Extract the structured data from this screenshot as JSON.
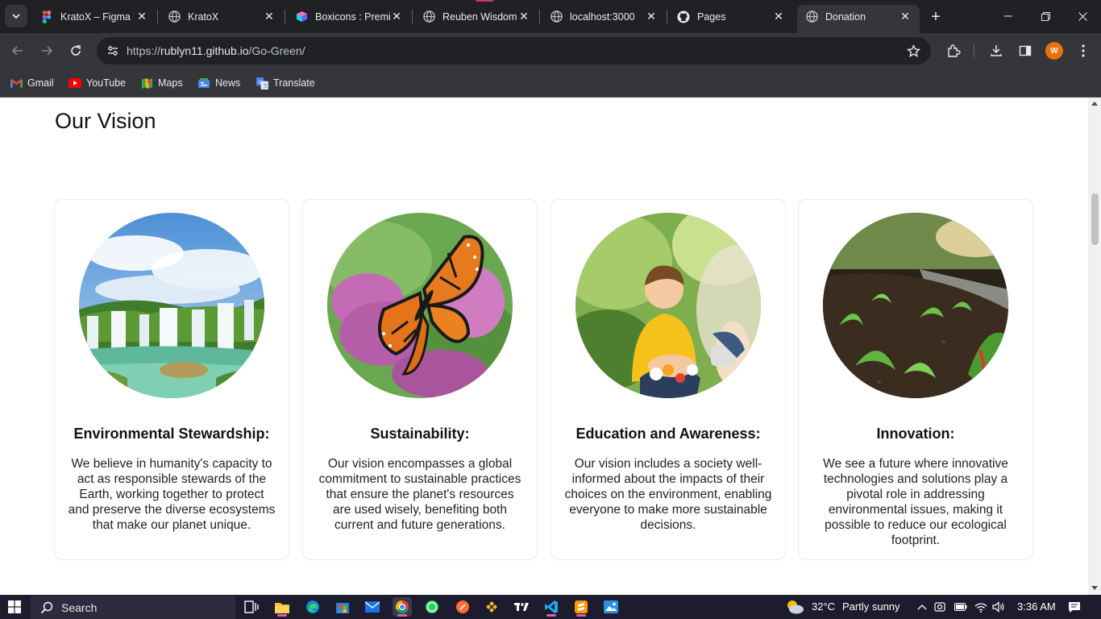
{
  "browser": {
    "tabs": [
      {
        "title": "KratoX – Figma",
        "icon": "figma-icon"
      },
      {
        "title": "KratoX",
        "icon": "globe-icon"
      },
      {
        "title": "Boxicons : Premi",
        "icon": "boxicons-icon"
      },
      {
        "title": "Reuben Wisdom",
        "icon": "globe-icon"
      },
      {
        "title": "localhost:3000",
        "icon": "globe-icon"
      },
      {
        "title": "Pages",
        "icon": "github-icon"
      },
      {
        "title": "Donation",
        "icon": "globe-icon",
        "active": true
      }
    ],
    "url_prefix": "https://",
    "url_host": "rublyn11.github.io",
    "url_path": "/Go-Green/",
    "profile_initial": "W",
    "bookmarks": [
      {
        "label": "Gmail",
        "icon": "gmail-icon"
      },
      {
        "label": "YouTube",
        "icon": "youtube-icon"
      },
      {
        "label": "Maps",
        "icon": "maps-icon"
      },
      {
        "label": "News",
        "icon": "news-icon"
      },
      {
        "label": "Translate",
        "icon": "translate-icon"
      }
    ]
  },
  "page": {
    "section_title": "Our Vision",
    "cards": [
      {
        "title": "Environmental Stewardship:",
        "text": "We believe in humanity's capacity to act as responsible stewards of the Earth, working together to protect and preserve the diverse ecosystems that make our planet unique.",
        "image": "waterfall-photo"
      },
      {
        "title": "Sustainability:",
        "text": "Our vision encompasses a global commitment to sustainable practices that ensure the planet's resources are used wisely, benefiting both current and future generations.",
        "image": "butterfly-photo"
      },
      {
        "title": "Education and Awareness:",
        "text": "Our vision includes a society well-informed about the impacts of their choices on the environment, enabling everyone to make more sustainable decisions.",
        "image": "child-gardening-photo"
      },
      {
        "title": "Innovation:",
        "text": "We see a future where innovative technologies and solutions play a pivotal role in addressing environmental issues, making it possible to reduce our ecological footprint.",
        "image": "seedlings-photo"
      }
    ]
  },
  "taskbar": {
    "search_label": "Search",
    "weather_temp": "32°C",
    "weather_desc": "Partly sunny",
    "time": "3:36 AM"
  },
  "colors": {
    "chrome_dark": "#202124",
    "chrome_toolbar": "#35363a",
    "taskbar": "#1c1c2e",
    "page_bg": "#ffffff"
  }
}
